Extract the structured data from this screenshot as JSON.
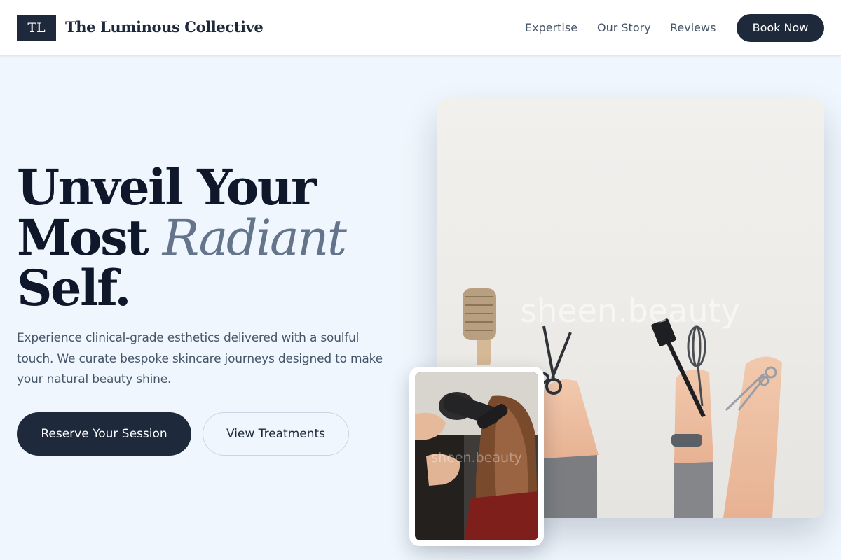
{
  "brand": {
    "mark": "TL",
    "name": "The Luminous Collective"
  },
  "nav": {
    "links": [
      "Expertise",
      "Our Story",
      "Reviews"
    ],
    "cta": "Book Now"
  },
  "hero": {
    "title_line1": "Unveil Your",
    "title_line2_plain": "Most ",
    "title_line2_accent": "Radiant",
    "title_line3": "Self.",
    "subtitle": "Experience clinical-grade esthetics delivered with a soulful touch. We curate bespoke skincare journeys designed to make your natural beauty shine.",
    "primary_button": "Reserve Your Session",
    "secondary_button": "View Treatments"
  },
  "images": {
    "main_watermark": "sheen.beauty",
    "inset_watermark": "sheen.beauty"
  },
  "colors": {
    "page_bg": "#eff6fd",
    "navy": "#1e293b",
    "accent_slate": "#64748b",
    "muted_text": "#475569"
  }
}
